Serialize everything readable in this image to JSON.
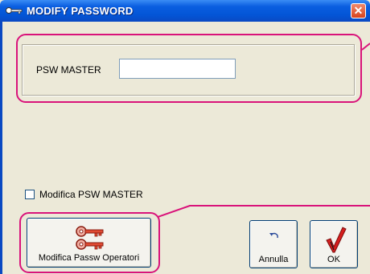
{
  "window": {
    "title": "MODIFY PASSWORD"
  },
  "icons": {
    "title": "key-icon",
    "close": "close-icon",
    "keys": "keys-icon",
    "undo": "undo-icon",
    "ok": "checkmark-icon"
  },
  "close_glyph": "✕",
  "fields": {
    "psw_master": {
      "label": "PSW MASTER",
      "value": ""
    }
  },
  "checkbox": {
    "label": "Modifica PSW MASTER",
    "checked": false
  },
  "buttons": {
    "modify_operators": "Modifica Passw Operatori",
    "cancel": "Annulla",
    "ok": "OK"
  },
  "colors": {
    "highlight": "#d9137a",
    "titlebar": "#0355d6",
    "close": "#d8431d"
  }
}
